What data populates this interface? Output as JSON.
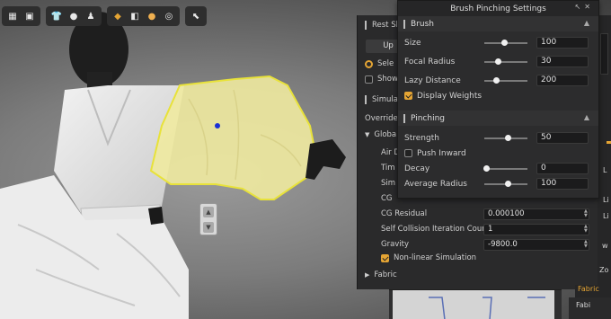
{
  "toolbar": {
    "group1": [
      "avatar-box-icon",
      "avatar-shirt-icon"
    ],
    "group2": [
      "tshirt-icon",
      "pins-icon",
      "person-icon"
    ],
    "group3": [
      "texture-icon",
      "material-icon",
      "light-icon",
      "globe-icon"
    ],
    "group4": [
      "select-arrow-icon"
    ]
  },
  "viewport": {
    "selection_color": "#e8e23a",
    "fabric_highlight": "#f0eaa0"
  },
  "back_panel": {
    "rest_section": "Rest Sh",
    "up_button": "Up",
    "select_label": "Sele",
    "show_label": "Show",
    "simulation_section": "Simulat",
    "override_label": "Override",
    "global_label": "Globa",
    "rows_partial": [
      "Air D",
      "Tim",
      "Sim",
      "CG"
    ],
    "cg_residual_label": "CG Residual",
    "cg_residual_value": "0.000100",
    "self_collision_label": "Self Collision Iteration Count",
    "self_collision_value": "1",
    "gravity_label": "Gravity",
    "gravity_value": "-9800.0",
    "nonlinear_label": "Non-linear Simulation",
    "fabric_section": "Fabric"
  },
  "right_strip": {
    "items": [
      "L",
      "Li",
      "Li",
      "w",
      "Zo"
    ],
    "fabric_tab": "Fabric",
    "fabric_label": "Fabi"
  },
  "dialog": {
    "title": "Brush Pinching Settings",
    "brush_section": "Brush",
    "size_label": "Size",
    "size_value": "100",
    "size_fraction": 0.45,
    "focal_label": "Focal Radius",
    "focal_value": "30",
    "focal_fraction": 0.3,
    "lazy_label": "Lazy Distance",
    "lazy_value": "200",
    "lazy_fraction": 0.25,
    "display_weights_label": "Display Weights",
    "pinching_section": "Pinching",
    "strength_label": "Strength",
    "strength_value": "50",
    "strength_fraction": 0.55,
    "push_inward_label": "Push Inward",
    "decay_label": "Decay",
    "decay_value": "0",
    "decay_fraction": 0.0,
    "avg_radius_label": "Average Radius",
    "avg_radius_value": "100",
    "avg_radius_fraction": 0.55
  },
  "colors": {
    "accent": "#e5a534",
    "panel": "#2c2c2d",
    "field": "#1b1b1c"
  }
}
